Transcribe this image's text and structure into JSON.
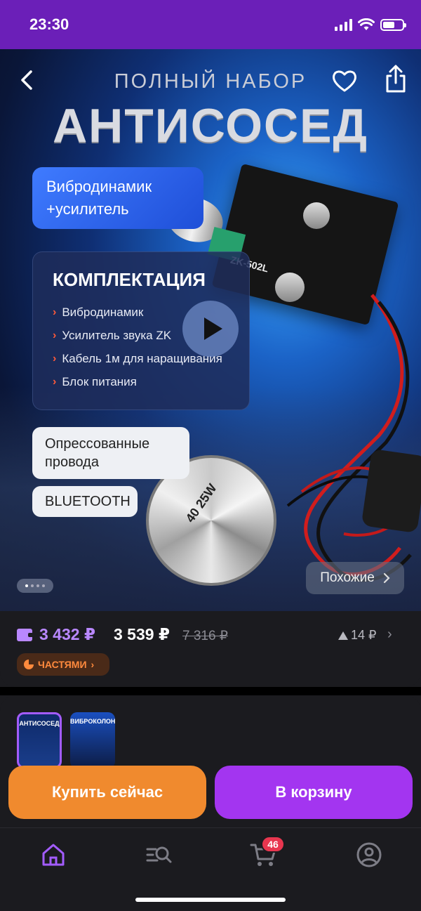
{
  "status_bar": {
    "time": "23:30"
  },
  "hero": {
    "subtitle": "ПОЛНЫЙ НАБОР",
    "title": "АНТИСОСЕД",
    "badge_blue": "Вибродинамик +усилитель",
    "kit": {
      "title": "КОМПЛЕКТАЦИЯ",
      "items": [
        "Вибродинамик",
        "Усилитель звука ZK",
        "Кабель 1м для наращивания",
        "Блок питания"
      ]
    },
    "chip_crimped": "Опрессованные провода",
    "chip_bluetooth": "BLUETOOTH",
    "board_label": "ZK-502L",
    "speaker_label": "40 25W",
    "similar_label": "Похожие",
    "carousel_dots": 4,
    "carousel_active": 0
  },
  "price": {
    "wallet_price": "3 432 ₽",
    "main_price": "3 539 ₽",
    "old_price": "7 316 ₽",
    "delta": "14 ₽",
    "installment_label": "ЧАСТЯМИ",
    "wallet_color": "#b988ff",
    "installment_color": "#ff8a3d"
  },
  "variants": [
    {
      "label": "АНТИСОСЕД",
      "selected": true
    },
    {
      "label": "ВИБРОКОЛОНКА",
      "selected": false
    }
  ],
  "actions": {
    "buy_now": "Купить сейчас",
    "add_to_cart": "В корзину",
    "buy_color": "#f08a2e",
    "cart_color": "#a335f0"
  },
  "bottom_nav": {
    "items": [
      "home-icon",
      "catalog-search-icon",
      "cart-icon",
      "profile-icon"
    ],
    "cart_badge": "46",
    "active_color": "#a35cff"
  }
}
